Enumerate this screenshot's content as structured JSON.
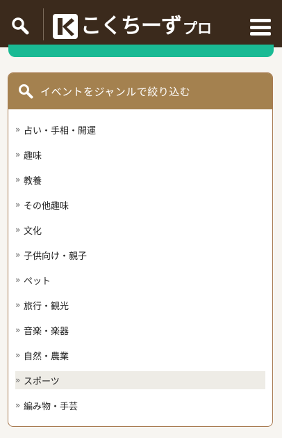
{
  "header": {
    "logo_text": "こくちーず",
    "logo_suffix": "プロ",
    "colors": {
      "background": "#3b2a1c",
      "logo_mark": "#ffffff"
    }
  },
  "accent_strip_color": "#1aba94",
  "genre_panel": {
    "title": "イベントをジャンルで絞り込む",
    "header_color": "#a4814f",
    "chevron": "»",
    "items": [
      {
        "label": "占い・手相・開運"
      },
      {
        "label": "趣味"
      },
      {
        "label": "教養"
      },
      {
        "label": "その他趣味"
      },
      {
        "label": "文化"
      },
      {
        "label": "子供向け・親子"
      },
      {
        "label": "ペット"
      },
      {
        "label": "旅行・観光"
      },
      {
        "label": "音楽・楽器"
      },
      {
        "label": "自然・農業"
      },
      {
        "label": "スポーツ",
        "highlighted": true
      },
      {
        "label": "編み物・手芸"
      }
    ]
  },
  "icons": [
    "search-icon",
    "logo-k-icon",
    "hamburger-menu-icon",
    "chevron-right-icon"
  ]
}
